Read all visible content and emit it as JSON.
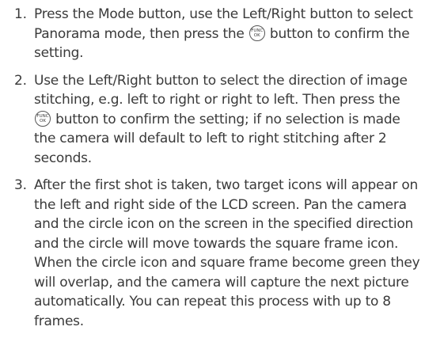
{
  "func_button": {
    "top": "FUNC",
    "bottom": "OK"
  },
  "steps": [
    {
      "number": "1.",
      "a": "Press the Mode button, use the Left/Right button to select Panorama mode, then press the",
      "b": "button to confirm the setting."
    },
    {
      "number": "2.",
      "a": "Use the Left/Right button to select the direction of image stitching, e.g. left to right or right to left. Then press the",
      "b": "button to confirm the setting; if no selection is made the camera will default to left to right stitching after 2 seconds."
    },
    {
      "number": "3.",
      "text": "After the first shot is taken, two target icons will appear on the left and right side of the LCD screen. Pan the camera and the circle icon on the screen in the specified direction and the circle will move towards the square frame icon. When the circle icon and square frame become green they will overlap, and the camera will capture the next picture automatically. You can repeat this process with up to 8 frames."
    }
  ]
}
